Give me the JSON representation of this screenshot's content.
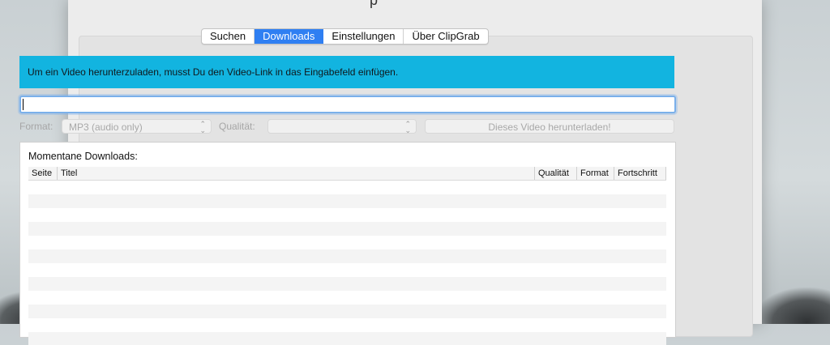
{
  "window": {
    "title_fragment": "p"
  },
  "tabs": [
    {
      "label": "Suchen",
      "active": false
    },
    {
      "label": "Downloads",
      "active": true
    },
    {
      "label": "Einstellungen",
      "active": false
    },
    {
      "label": "Über ClipGrab",
      "active": false
    }
  ],
  "banner": {
    "text": "Um ein Video herunterzuladen, musst Du den Video-Link in das Eingabefeld einfügen.",
    "color": "#12b4e0"
  },
  "url_input": {
    "value": ""
  },
  "options": {
    "format_label": "Format:",
    "format_value": "MP3 (audio only)",
    "quality_label": "Qualität:",
    "quality_value": "",
    "download_button": "Dieses Video herunterladen!"
  },
  "downloads": {
    "title": "Momentane Downloads:",
    "columns": [
      "Seite",
      "Titel",
      "Qualität",
      "Format",
      "Fortschritt"
    ],
    "rows": []
  },
  "colors": {
    "accent": "#2f7ff2",
    "banner": "#12b4e0"
  }
}
